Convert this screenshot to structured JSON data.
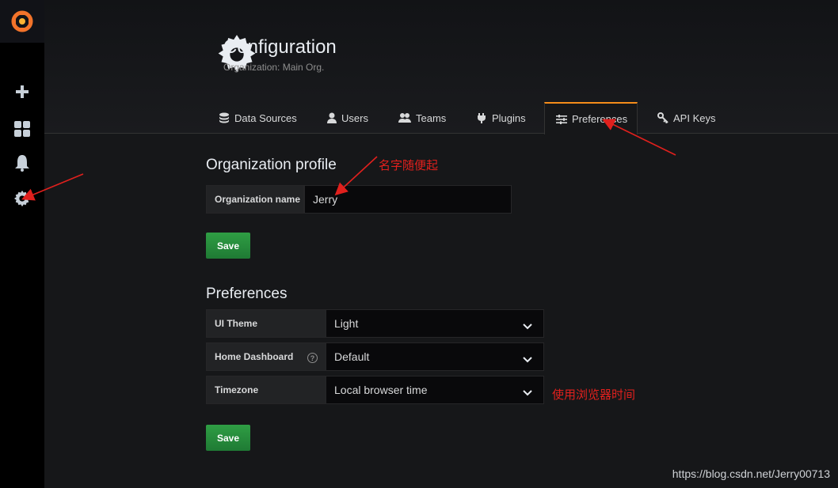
{
  "header": {
    "title": "Configuration",
    "subtitle": "Organization: Main Org."
  },
  "tabs": [
    {
      "label": "Data Sources",
      "icon": "database-icon"
    },
    {
      "label": "Users",
      "icon": "user-icon"
    },
    {
      "label": "Teams",
      "icon": "users-icon"
    },
    {
      "label": "Plugins",
      "icon": "plug-icon"
    },
    {
      "label": "Preferences",
      "icon": "sliders-icon",
      "active": true
    },
    {
      "label": "API Keys",
      "icon": "key-icon"
    }
  ],
  "sidebar": {
    "items": [
      "grafana-logo",
      "plus-icon",
      "dashboards-icon",
      "bell-icon",
      "gear-icon"
    ]
  },
  "org_profile": {
    "title": "Organization profile",
    "name_label": "Organization name",
    "name_value": "Jerry",
    "save_label": "Save"
  },
  "preferences": {
    "title": "Preferences",
    "ui_theme_label": "UI Theme",
    "ui_theme_value": "Light",
    "home_dashboard_label": "Home Dashboard",
    "home_dashboard_value": "Default",
    "help_glyph": "?",
    "timezone_label": "Timezone",
    "timezone_value": "Local browser time",
    "save_label": "Save"
  },
  "annotations": {
    "name_note": "名字随便起",
    "timezone_note": "使用浏览器时间",
    "color": "#e0201d"
  },
  "watermark": "https://blog.csdn.net/Jerry00713",
  "colors": {
    "accent": "#f58c1a",
    "save_green": "#299c46",
    "background": "#161719"
  }
}
